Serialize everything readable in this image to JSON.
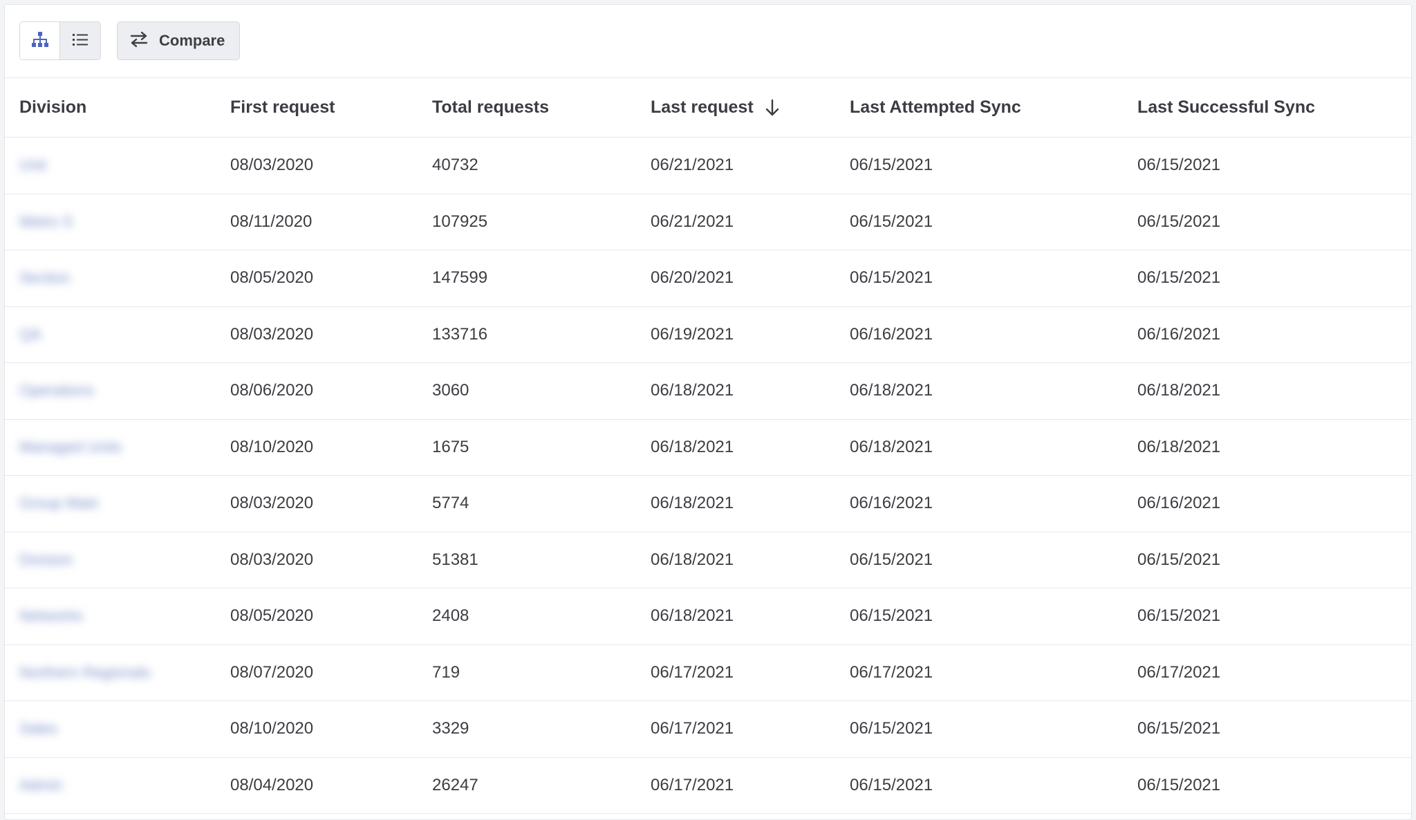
{
  "toolbar": {
    "tree_view_icon": "hierarchy-icon",
    "list_view_icon": "list-icon",
    "compare_icon": "swap-arrows-icon",
    "compare_label": "Compare"
  },
  "table": {
    "columns": [
      {
        "label": "Division"
      },
      {
        "label": "First request"
      },
      {
        "label": "Total requests"
      },
      {
        "label": "Last request",
        "sort_icon": "arrow-down-icon"
      },
      {
        "label": "Last Attempted Sync"
      },
      {
        "label": "Last Successful Sync"
      }
    ],
    "rows": [
      {
        "division": "Unit",
        "first": "08/03/2020",
        "total": "40732",
        "last": "06/21/2021",
        "attempted": "06/15/2021",
        "successful": "06/15/2021"
      },
      {
        "division": "Metro S",
        "first": "08/11/2020",
        "total": "107925",
        "last": "06/21/2021",
        "attempted": "06/15/2021",
        "successful": "06/15/2021"
      },
      {
        "division": "Section",
        "first": "08/05/2020",
        "total": "147599",
        "last": "06/20/2021",
        "attempted": "06/15/2021",
        "successful": "06/15/2021"
      },
      {
        "division": "QA",
        "first": "08/03/2020",
        "total": "133716",
        "last": "06/19/2021",
        "attempted": "06/16/2021",
        "successful": "06/16/2021"
      },
      {
        "division": "Operations",
        "first": "08/06/2020",
        "total": "3060",
        "last": "06/18/2021",
        "attempted": "06/18/2021",
        "successful": "06/18/2021"
      },
      {
        "division": "Managed Units",
        "first": "08/10/2020",
        "total": "1675",
        "last": "06/18/2021",
        "attempted": "06/18/2021",
        "successful": "06/18/2021"
      },
      {
        "division": "Group Main",
        "first": "08/03/2020",
        "total": "5774",
        "last": "06/18/2021",
        "attempted": "06/16/2021",
        "successful": "06/16/2021"
      },
      {
        "division": "Division",
        "first": "08/03/2020",
        "total": "51381",
        "last": "06/18/2021",
        "attempted": "06/15/2021",
        "successful": "06/15/2021"
      },
      {
        "division": "Networks",
        "first": "08/05/2020",
        "total": "2408",
        "last": "06/18/2021",
        "attempted": "06/15/2021",
        "successful": "06/15/2021"
      },
      {
        "division": "Northern Regionals",
        "first": "08/07/2020",
        "total": "719",
        "last": "06/17/2021",
        "attempted": "06/17/2021",
        "successful": "06/17/2021"
      },
      {
        "division": "Sales",
        "first": "08/10/2020",
        "total": "3329",
        "last": "06/17/2021",
        "attempted": "06/15/2021",
        "successful": "06/15/2021"
      },
      {
        "division": "Admin",
        "first": "08/04/2020",
        "total": "26247",
        "last": "06/17/2021",
        "attempted": "06/15/2021",
        "successful": "06/15/2021"
      }
    ]
  },
  "colors": {
    "accent": "#4a66c4",
    "border": "#e2e4e8",
    "text": "#3b3d42"
  }
}
